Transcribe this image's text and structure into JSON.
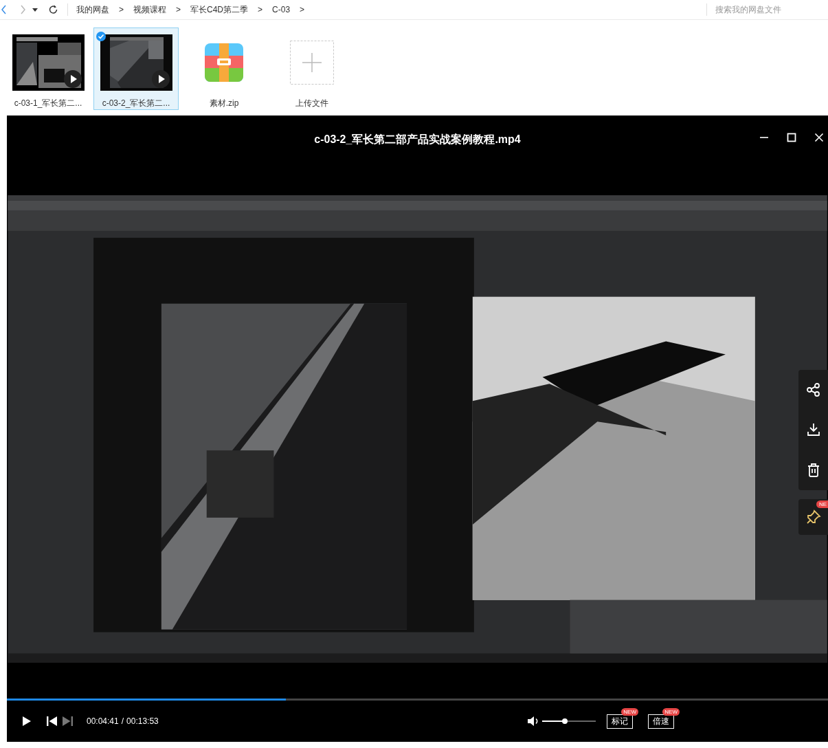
{
  "nav": {
    "buttons": [
      {
        "kind": "back",
        "disabled": false
      },
      {
        "kind": "forward",
        "disabled": true
      },
      {
        "kind": "history",
        "disabled": false
      },
      {
        "kind": "refresh",
        "disabled": false
      }
    ]
  },
  "breadcrumb": {
    "separator": ">",
    "items": [
      "我的网盘",
      "视频课程",
      "军长C4D第二季",
      "C-03"
    ]
  },
  "search": {
    "placeholder": "搜索我的网盘文件"
  },
  "files": [
    {
      "kind": "video",
      "name": "c-03-1_军长第二...",
      "selected": false
    },
    {
      "kind": "video",
      "name": "c-03-2_军长第二...",
      "selected": true
    },
    {
      "kind": "zip",
      "name": "素材.zip",
      "selected": false
    },
    {
      "kind": "upload",
      "name": "上传文件",
      "selected": false
    }
  ],
  "player": {
    "title": "c-03-2_军长第二部产品实战案例教程.mp4",
    "progress": {
      "level": 0.34
    },
    "time_current": "00:04:41",
    "time_separator": "/",
    "time_total": "00:13:53",
    "volume": {
      "level": 0.42
    },
    "buttons": [
      {
        "label": "标记",
        "badge": "NEW"
      },
      {
        "label": "倍速",
        "badge": "NEW"
      }
    ]
  },
  "side_actions": [
    {
      "kind": "share"
    },
    {
      "kind": "download"
    },
    {
      "kind": "delete"
    }
  ],
  "pin": {
    "badge": "NE"
  }
}
